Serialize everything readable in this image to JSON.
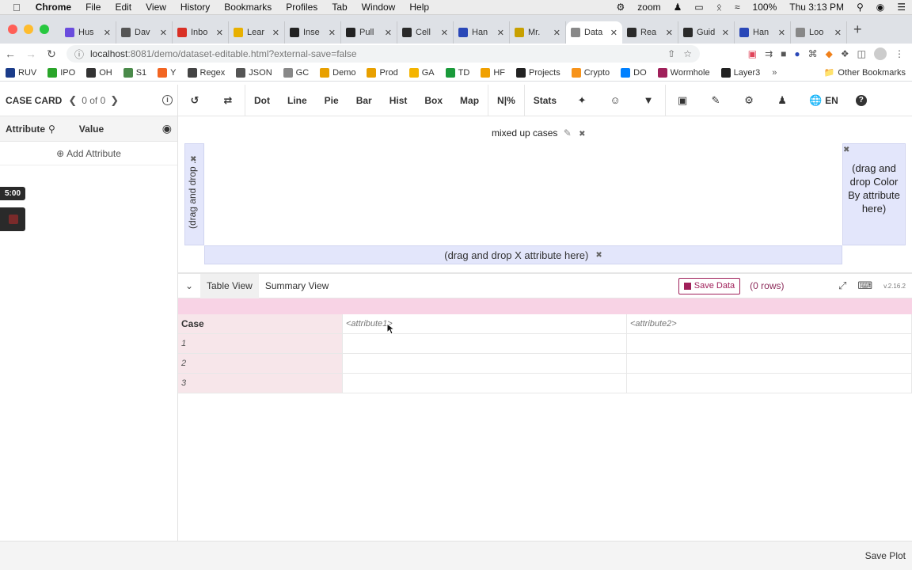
{
  "menubar": {
    "app": "Chrome",
    "menus": [
      "File",
      "Edit",
      "View",
      "History",
      "Bookmarks",
      "Profiles",
      "Tab",
      "Window",
      "Help"
    ],
    "zoom_label": "zoom",
    "battery": "100%",
    "clock": "Thu 3:13 PM"
  },
  "tabs": [
    {
      "title": "Hus",
      "color": "#6a4cdd",
      "active": false
    },
    {
      "title": "Dav",
      "color": "#555555",
      "active": false
    },
    {
      "title": "Inbo",
      "color": "#d93025",
      "active": false
    },
    {
      "title": "Lear",
      "color": "#e8b000",
      "active": false
    },
    {
      "title": "Inse",
      "color": "#222222",
      "active": false
    },
    {
      "title": "Pull",
      "color": "#222222",
      "active": false
    },
    {
      "title": "Cell",
      "color": "#2a2a2a",
      "active": false
    },
    {
      "title": "Han",
      "color": "#2a48b8",
      "active": false
    },
    {
      "title": "Mr.",
      "color": "#c8a000",
      "active": false
    },
    {
      "title": "Data",
      "color": "#888888",
      "active": true
    },
    {
      "title": "Rea",
      "color": "#2a2a2a",
      "active": false
    },
    {
      "title": "Guid",
      "color": "#2a2a2a",
      "active": false
    },
    {
      "title": "Han",
      "color": "#2a48b8",
      "active": false
    },
    {
      "title": "Loo",
      "color": "#888888",
      "active": false
    }
  ],
  "address": {
    "host": "localhost",
    "rest": ":8081/demo/dataset-editable.html?external-save=false"
  },
  "bookmarks": [
    {
      "label": "RUV",
      "color": "#1b3c8a"
    },
    {
      "label": "IPO",
      "color": "#2aa52a"
    },
    {
      "label": "OH",
      "color": "#333333"
    },
    {
      "label": "S1",
      "color": "#4a8a4a"
    },
    {
      "label": "Y",
      "color": "#f26522"
    },
    {
      "label": "Regex",
      "color": "#444444"
    },
    {
      "label": "JSON",
      "color": "#555555"
    },
    {
      "label": "GC",
      "color": "#888888"
    },
    {
      "label": "Demo",
      "color": "#e8a000"
    },
    {
      "label": "Prod",
      "color": "#e8a000"
    },
    {
      "label": "GA",
      "color": "#f4b400"
    },
    {
      "label": "TD",
      "color": "#1a9a3a"
    },
    {
      "label": "HF",
      "color": "#f0a000"
    },
    {
      "label": "Projects",
      "color": "#222222"
    },
    {
      "label": "Crypto",
      "color": "#f7931a"
    },
    {
      "label": "DO",
      "color": "#0080ff"
    },
    {
      "label": "Wormhole",
      "color": "#a0205a"
    },
    {
      "label": "Layer3",
      "color": "#222222"
    }
  ],
  "other_bookmarks": "Other Bookmarks",
  "casecard": {
    "title": "CASE CARD",
    "count": "0 of 0",
    "col_attribute": "Attribute",
    "col_value": "Value",
    "add_attribute": "Add Attribute",
    "timer": "5:00"
  },
  "toolbar": {
    "items": [
      "Dot",
      "Line",
      "Pie",
      "Bar",
      "Hist",
      "Box",
      "Map",
      "N|%",
      "Stats"
    ],
    "lang": "EN"
  },
  "plot": {
    "title": "mixed up cases",
    "y_drop": "(drag and drop ...",
    "x_drop": "(drag and drop X attribute here)",
    "color_drop": "(drag and drop Color By attribute here)"
  },
  "table": {
    "tab_table": "Table View",
    "tab_summary": "Summary View",
    "save_data": "Save Data",
    "rows": "(0 rows)",
    "version": "v.2.16.2",
    "header_case": "Case",
    "attributes": [
      "<attribute1>",
      "<attribute2>"
    ],
    "row_labels": [
      "1",
      "2",
      "3"
    ]
  },
  "footer": {
    "save_plot": "Save Plot"
  }
}
